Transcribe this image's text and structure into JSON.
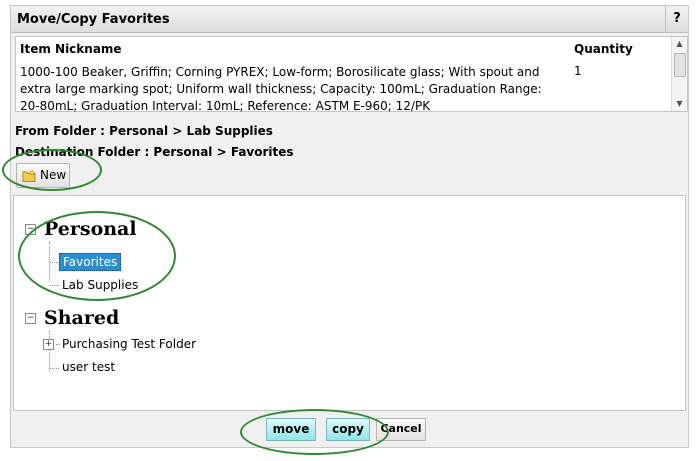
{
  "dialog": {
    "title": "Move/Copy Favorites",
    "help_label": "?"
  },
  "item_table": {
    "col_name": "Item Nickname",
    "col_qty": "Quantity",
    "description": "1000-100 Beaker, Griffin; Corning PYREX; Low-form; Borosilicate glass; With spout and extra large marking spot; Uniform wall thickness; Capacity: 100mL; Graduation Range: 20-80mL; Graduation Interval: 10mL; Reference: ASTM E-960; 12/PK",
    "quantity": "1"
  },
  "from_folder": "From Folder : Personal > Lab Supplies",
  "destination_folder": "Destination Folder : Personal > Favorites",
  "new_button": {
    "label": "New",
    "icon": "new-folder-icon"
  },
  "tree": {
    "personal": {
      "label": "Personal",
      "toggle": "−",
      "children": [
        "Favorites",
        "Lab Supplies"
      ],
      "selected": "Favorites"
    },
    "shared": {
      "label": "Shared",
      "toggle": "−",
      "children": [
        {
          "label": "Purchasing Test Folder",
          "toggle": "+"
        },
        {
          "label": "user test"
        }
      ]
    }
  },
  "actions": {
    "move": "move",
    "copy": "copy",
    "cancel": "Cancel"
  },
  "colors": {
    "highlight": "#2e8a2e",
    "selection": "#2a8fd0",
    "action_button": "#8ee6ea"
  }
}
